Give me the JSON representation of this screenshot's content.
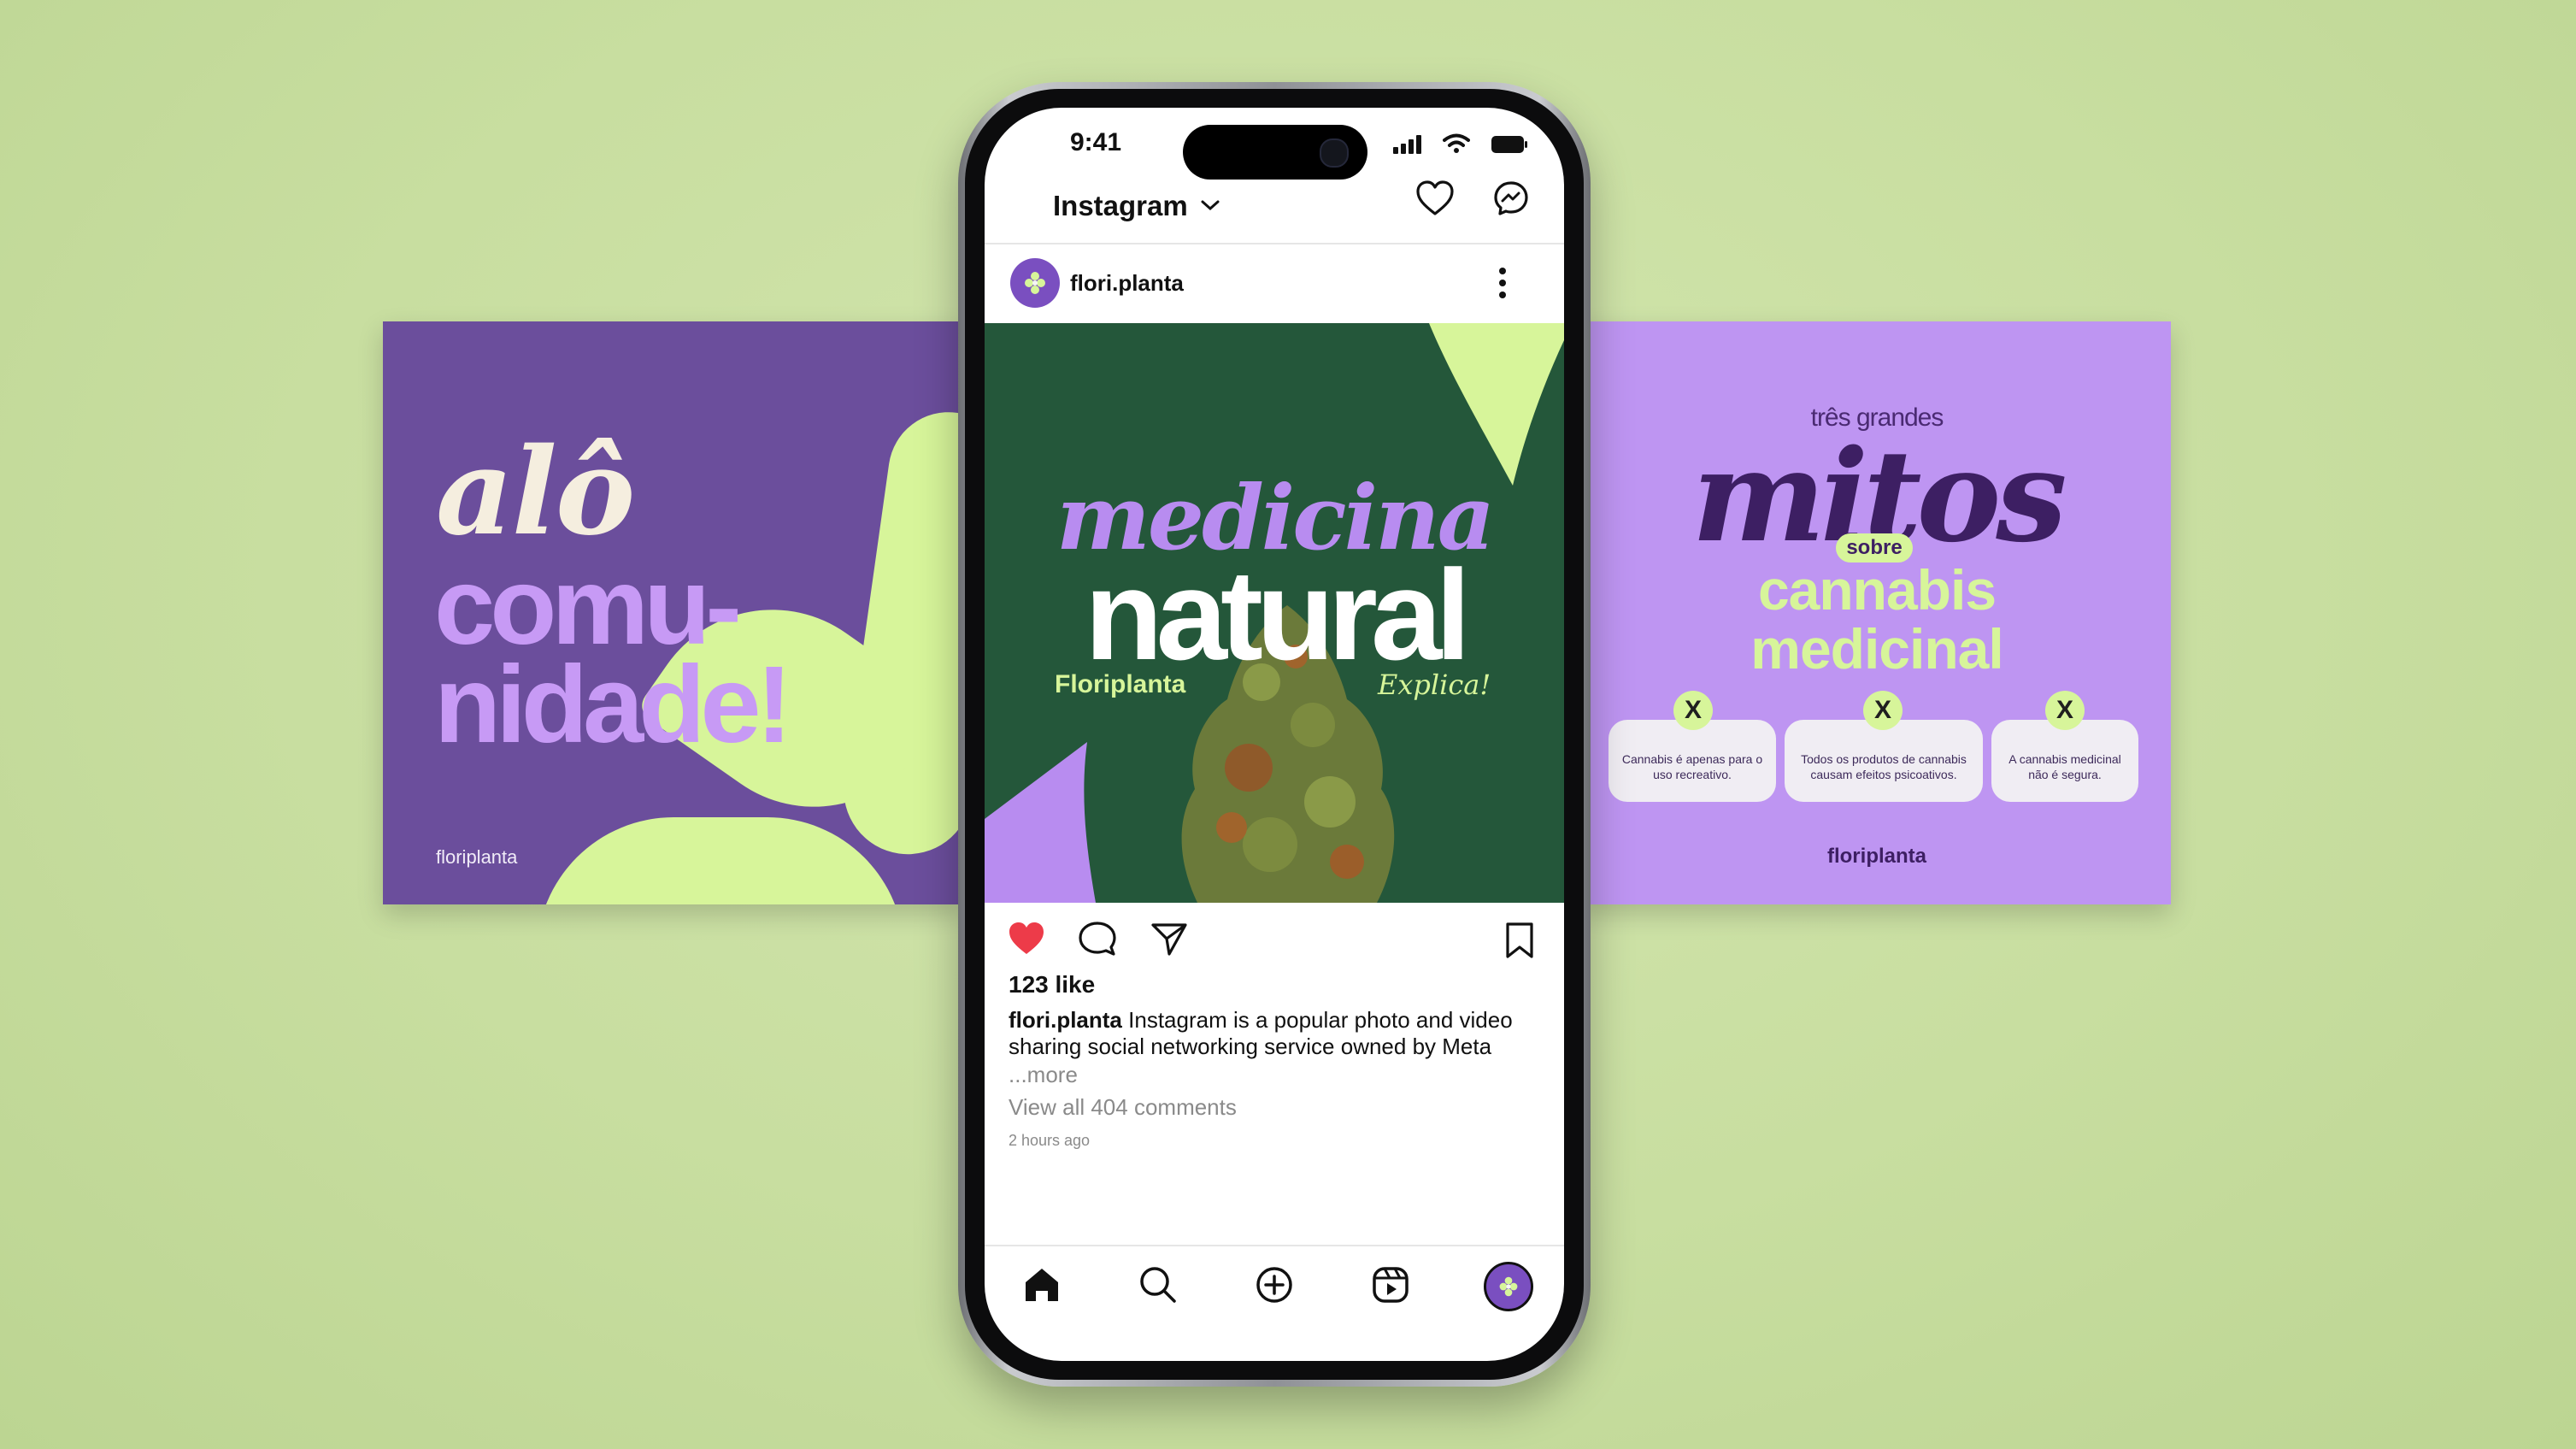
{
  "colors": {
    "background": "#c8dea0",
    "purple_dark": "#6b4e9c",
    "purple_light": "#be95f2",
    "lime": "#d7f59a",
    "forest_green": "#24573a",
    "like_red": "#ed3b49"
  },
  "left_card": {
    "line1": "alô",
    "line2": "comu-",
    "line3": "nidade!",
    "brand": "floriplanta"
  },
  "right_card": {
    "kicker": "três grandes",
    "headline": "mitos",
    "pill": "sobre",
    "subhead_line1": "cannabis",
    "subhead_line2": "medicinal",
    "myths": [
      {
        "badge": "X",
        "text": "Cannabis é apenas para o uso recreativo."
      },
      {
        "badge": "X",
        "text": "Todos os produtos de cannabis causam efeitos psicoativos."
      },
      {
        "badge": "X",
        "text": "A cannabis medicinal não é segura."
      }
    ],
    "brand": "floriplanta"
  },
  "phone": {
    "status_time": "9:41",
    "app_title": "Instagram",
    "header_icons": [
      "chevron-down-icon",
      "heart-icon",
      "messenger-icon"
    ],
    "post": {
      "username": "flori.planta",
      "image": {
        "line1": "medicina",
        "line2": "natural",
        "brand": "Floriplanta",
        "tag": "Explica!"
      },
      "likes": "123 like",
      "caption_user": "flori.planta",
      "caption_text": "Instagram is a popular photo and video sharing social networking service owned by Meta",
      "more": "...more",
      "view_comments": "View all 404 comments",
      "time_ago": "2 hours ago"
    },
    "nav_icons": [
      "home-icon",
      "search-icon",
      "add-post-icon",
      "reels-icon",
      "profile-avatar"
    ]
  }
}
